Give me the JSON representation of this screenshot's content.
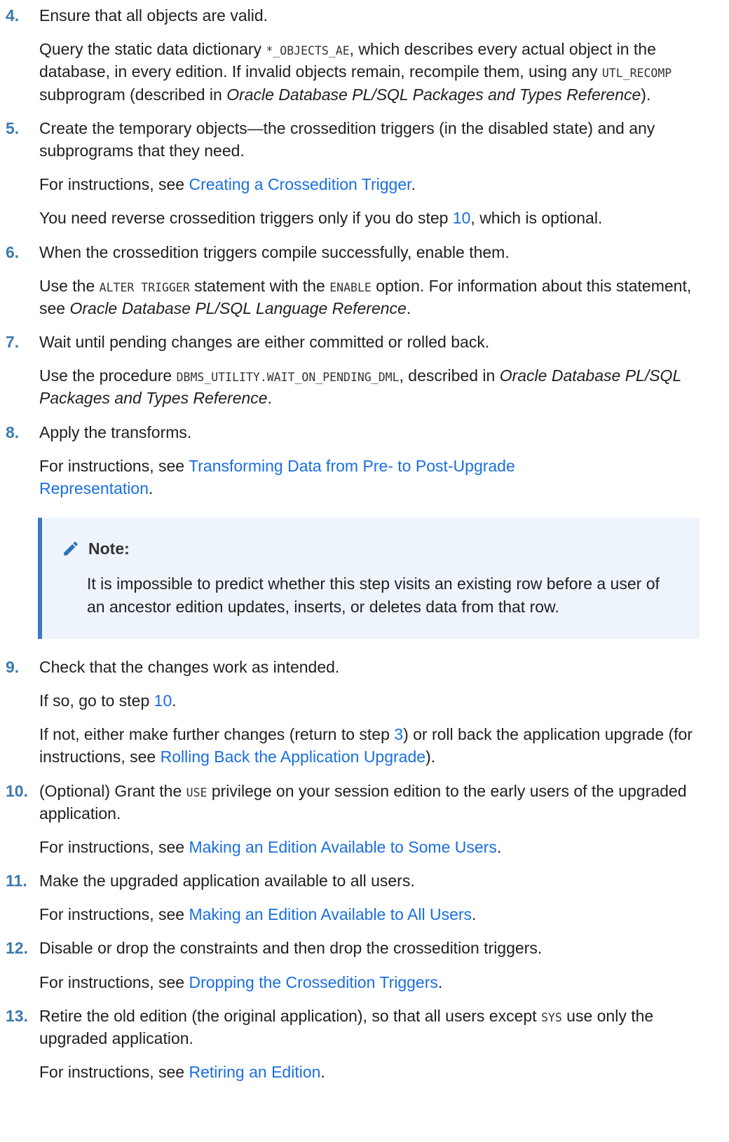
{
  "steps": [
    {
      "num": "4.",
      "lead": "Ensure that all objects are valid.",
      "p1": [
        "Query the static data dictionary ",
        "*_OBJECTS_AE",
        ", which describes every actual object in the database, in every edition. If invalid objects remain, recompile them, using any ",
        "UTL_RECOMP",
        " subprogram (described in ",
        "Oracle Database PL/SQL Packages and Types Reference",
        ")."
      ]
    },
    {
      "num": "5.",
      "lead": "Create the temporary objects—the crossedition triggers (in the disabled state) and any subprograms that they need.",
      "p1": [
        "For instructions, see ",
        "Creating a Crossedition Trigger",
        "."
      ],
      "p2": [
        "You need reverse crossedition triggers only if you do step ",
        "10",
        ", which is optional."
      ]
    },
    {
      "num": "6.",
      "lead": "When the crossedition triggers compile successfully, enable them.",
      "p1": [
        "Use the ",
        "ALTER TRIGGER",
        " statement with the ",
        "ENABLE",
        " option. For information about this statement, see ",
        "Oracle Database PL/SQL Language Reference",
        "."
      ]
    },
    {
      "num": "7.",
      "lead": "Wait until pending changes are either committed or rolled back.",
      "p1": [
        "Use the procedure ",
        "DBMS_UTILITY.WAIT_ON_PENDING_DML",
        ", described in ",
        "Oracle Database PL/SQL Packages and Types Reference",
        "."
      ]
    },
    {
      "num": "8.",
      "lead": "Apply the transforms.",
      "p1": [
        "For instructions, see ",
        "Transforming Data from Pre- to Post-Upgrade Representation",
        "."
      ]
    },
    {
      "num": "9.",
      "lead": "Check that the changes work as intended.",
      "p1": [
        "If so, go to step ",
        "10",
        "."
      ],
      "p2": [
        "If not, either make further changes (return to step ",
        "3",
        ") or roll back the application upgrade (for instructions, see ",
        "Rolling Back the Application Upgrade",
        ")."
      ]
    },
    {
      "num": "10.",
      "lead": [
        "(Optional) Grant the ",
        "USE",
        " privilege on your session edition to the early users of the upgraded application."
      ],
      "p1": [
        "For instructions, see ",
        "Making an Edition Available to Some Users",
        "."
      ]
    },
    {
      "num": "11.",
      "lead": "Make the upgraded application available to all users.",
      "p1": [
        "For instructions, see ",
        "Making an Edition Available to All Users",
        "."
      ]
    },
    {
      "num": "12.",
      "lead": "Disable or drop the constraints and then drop the crossedition triggers.",
      "p1": [
        "For instructions, see ",
        "Dropping the Crossedition Triggers",
        "."
      ]
    },
    {
      "num": "13.",
      "lead": [
        "Retire the old edition (the original application), so that all users except ",
        "SYS",
        " use only the upgraded application."
      ],
      "p1": [
        "For instructions, see ",
        "Retiring an Edition",
        "."
      ]
    }
  ],
  "note": {
    "title": "Note:",
    "icon": "pencil-icon",
    "body": "It is impossible to predict whether this step visits an existing row before a user of an ancestor edition updates, inserts, or deletes data from that row."
  },
  "colors": {
    "step_number": "#3d79ad",
    "link": "#1a6fe0",
    "note_bg": "#eef4fb",
    "note_border": "#3b78c2",
    "note_icon": "#2f6fbe"
  }
}
